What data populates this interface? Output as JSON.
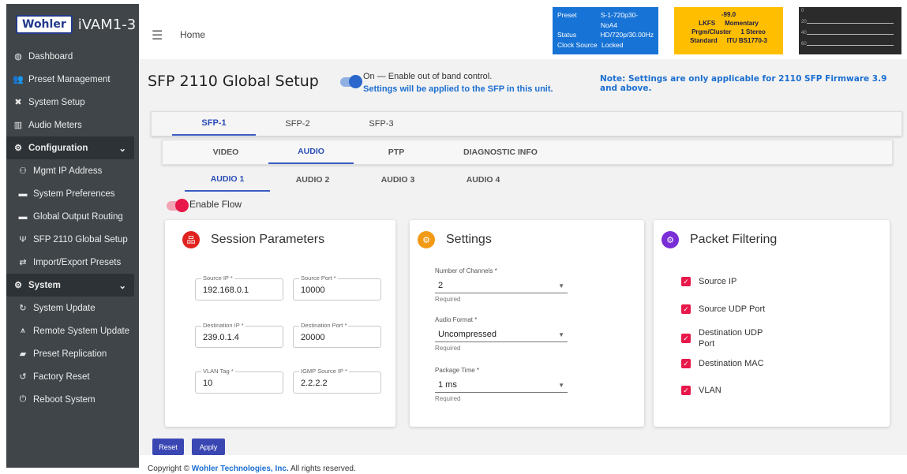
{
  "app": {
    "logo_badge": "Wohler",
    "product": "iVAM1-3"
  },
  "sidebar": {
    "items": [
      {
        "label": "Dashboard",
        "icon": "dashboard-icon"
      },
      {
        "label": "Preset Management",
        "icon": "users-icon"
      },
      {
        "label": "System Setup",
        "icon": "tools-icon"
      },
      {
        "label": "Audio Meters",
        "icon": "chart-icon"
      },
      {
        "label": "Configuration",
        "icon": "gear-icon"
      },
      {
        "label": "Mgmt IP Address",
        "icon": "network-icon"
      },
      {
        "label": "System Preferences",
        "icon": "keyboard-icon"
      },
      {
        "label": "Global Output Routing",
        "icon": "keyboard-icon"
      },
      {
        "label": "SFP 2110 Global Setup",
        "icon": "plug-icon"
      },
      {
        "label": "Import/Export Presets",
        "icon": "arrows-icon"
      },
      {
        "label": "System",
        "icon": "gears-icon"
      },
      {
        "label": "System Update",
        "icon": "sync-icon"
      },
      {
        "label": "Remote System Update",
        "icon": "antenna-icon"
      },
      {
        "label": "Preset Replication",
        "icon": "bookmark-icon"
      },
      {
        "label": "Factory Reset",
        "icon": "undo-icon"
      },
      {
        "label": "Reboot System",
        "icon": "power-icon"
      }
    ]
  },
  "topbar": {
    "home": "Home"
  },
  "status": {
    "preset_label": "Preset",
    "preset_value": "S-1-720p30-NoA4",
    "status_label": "Status",
    "status_value": "HD/720p/30.00Hz",
    "clock_label": "Clock Source",
    "clock_value": "Locked"
  },
  "loudness": {
    "value": "-99.0",
    "unit": "LKFS",
    "mode": "Momentary",
    "cluster_label": "Prgm/Cluster",
    "cluster_value": "1 Stereo",
    "standard_label": "Standard",
    "standard_value": "ITU BS1770-3"
  },
  "meter": {
    "ticks": [
      "0",
      "20",
      "40",
      "60"
    ]
  },
  "page": {
    "title": "SFP 2110 Global Setup",
    "oob_label": "On — Enable out of band control.",
    "oob_note": "Settings will be applied to the SFP in this unit.",
    "fw_note": "Note: Settings are only applicable for 2110 SFP Firmware 3.9 and above."
  },
  "tabs_sfp": [
    "SFP-1",
    "SFP-2",
    "SFP-3"
  ],
  "tabs_type": [
    "VIDEO",
    "AUDIO",
    "PTP",
    "DIAGNOSTIC INFO"
  ],
  "tabs_audio": [
    "AUDIO 1",
    "AUDIO 2",
    "AUDIO 3",
    "AUDIO 4"
  ],
  "enable_flow": "Enable Flow",
  "session": {
    "title": "Session Parameters",
    "source_ip": {
      "label": "Source IP *",
      "value": "192.168.0.1"
    },
    "source_port": {
      "label": "Source Port *",
      "value": "10000"
    },
    "dest_ip": {
      "label": "Destination IP *",
      "value": "239.0.1.4"
    },
    "dest_port": {
      "label": "Destination Port *",
      "value": "20000"
    },
    "vlan": {
      "label": "VLAN Tag *",
      "value": "10"
    },
    "igmp": {
      "label": "IGMP Source IP *",
      "value": "2.2.2.2"
    }
  },
  "settings": {
    "title": "Settings",
    "channels": {
      "label": "Number of Channels *",
      "value": "2",
      "help": "Required"
    },
    "format": {
      "label": "Audio Format *",
      "value": "Uncompressed",
      "help": "Required"
    },
    "ptime": {
      "label": "Package Time *",
      "value": "1 ms",
      "help": "Required"
    }
  },
  "filtering": {
    "title": "Packet Filtering",
    "items": [
      "Source IP",
      "Source UDP Port",
      "Destination UDP Port",
      "Destination MAC",
      "VLAN"
    ]
  },
  "buttons": {
    "reset": "Reset",
    "apply": "Apply"
  },
  "footer": {
    "prefix": "Copyright ©",
    "company": "Wohler Technologies, Inc.",
    "suffix": "All rights reserved."
  },
  "colors": {
    "sidebar_bg": "#3f4549",
    "status_blue": "#1773d6",
    "loudness_yellow": "#ffbe00",
    "accent_blue": "#2b4db6",
    "check_red": "#e8184a"
  }
}
